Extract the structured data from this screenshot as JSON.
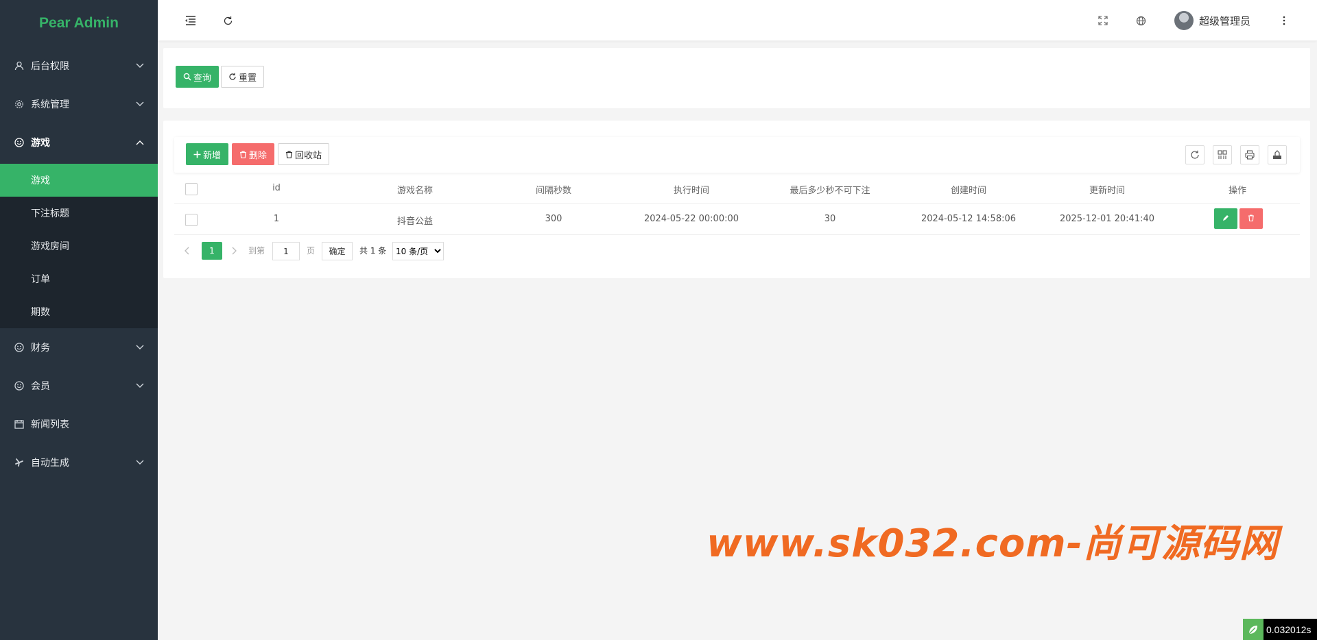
{
  "app": {
    "title": "Pear Admin",
    "brand_color": "#36b368"
  },
  "sidebar": {
    "items": [
      {
        "label": "后台权限",
        "icon": "user-icon",
        "expanded": false
      },
      {
        "label": "系统管理",
        "icon": "gear-icon",
        "expanded": false
      },
      {
        "label": "游戏",
        "icon": "smile-icon",
        "expanded": true
      },
      {
        "label": "财务",
        "icon": "smile-icon",
        "expanded": false
      },
      {
        "label": "会员",
        "icon": "smile-icon",
        "expanded": false
      },
      {
        "label": "新闻列表",
        "icon": "calendar-icon",
        "expanded": false
      },
      {
        "label": "自动生成",
        "icon": "fan-icon",
        "expanded": false
      }
    ],
    "submenu": [
      "游戏",
      "下注标题",
      "游戏房间",
      "订单",
      "期数"
    ],
    "active_submenu": "游戏"
  },
  "header": {
    "user_name": "超级管理员",
    "icons": [
      "menu-fold-icon",
      "refresh-icon",
      "fullscreen-icon",
      "globe-icon",
      "more-icon"
    ]
  },
  "search": {
    "query_label": "查询",
    "reset_label": "重置"
  },
  "toolbar": {
    "add_label": "新增",
    "delete_label": "删除",
    "recycle_label": "回收站"
  },
  "table": {
    "columns": [
      "id",
      "游戏名称",
      "间隔秒数",
      "执行时间",
      "最后多少秒不可下注",
      "创建时间",
      "更新时间",
      "操作"
    ],
    "rows": [
      {
        "id": "1",
        "name": "抖音公益",
        "interval": "300",
        "exec_time": "2024-05-22 00:00:00",
        "last_seconds": "30",
        "created": "2024-05-12 14:58:06",
        "updated": "2025-12-01 20:41:40"
      }
    ]
  },
  "pagination": {
    "current_page": "1",
    "goto_label": "到第",
    "goto_value": "1",
    "page_unit": "页",
    "confirm_label": "确定",
    "total_text": "共 1 条",
    "page_size": "10 条/页"
  },
  "watermark": "www.sk032.com-尚可源码网",
  "timer": "0.032012s"
}
